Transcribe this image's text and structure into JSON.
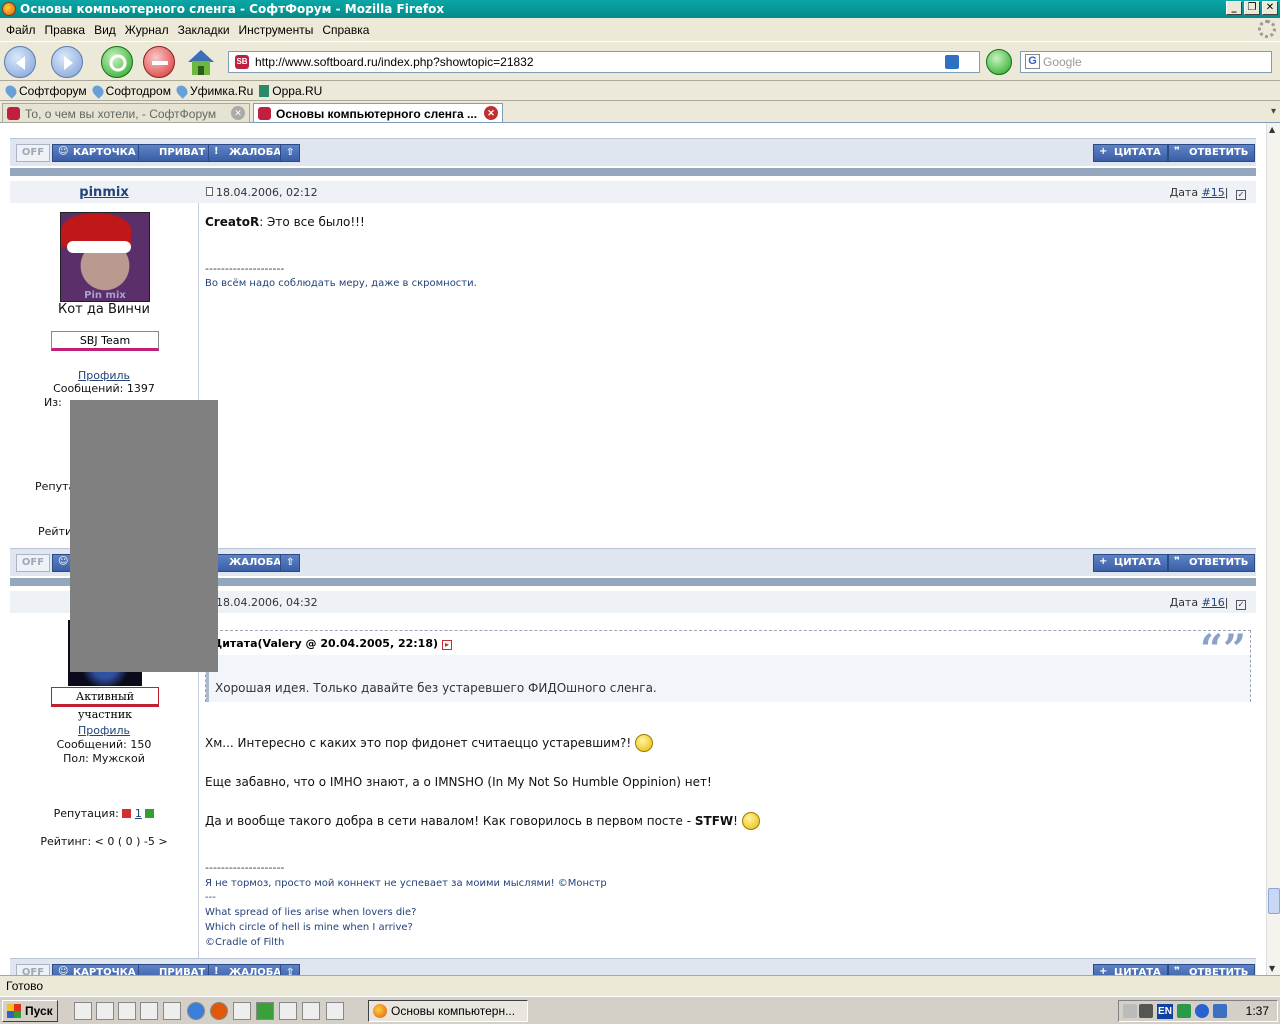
{
  "window": {
    "title": "Основы компьютерного сленга - СофтФорум - Mozilla Firefox",
    "buttons": [
      "_",
      "❐",
      "✕"
    ]
  },
  "menu": [
    "Файл",
    "Правка",
    "Вид",
    "Журнал",
    "Закладки",
    "Инструменты",
    "Справка"
  ],
  "nav": {
    "url": "http://www.softboard.ru/index.php?showtopic=21832",
    "search_placeholder": "Google"
  },
  "bookmarks": [
    "Софтфорум",
    "Софтодром",
    "Уфимка.Ru",
    "Oppa.RU"
  ],
  "tabs": [
    {
      "label": "То, о чем вы хотели, - СофтФорум"
    },
    {
      "label": "Основы компьютерного сленга ..."
    }
  ],
  "postbar": {
    "off": "OFF",
    "card": "КАРТОЧКА",
    "private": "ПРИВАТ",
    "complaint": "ЖАЛОБА",
    "up": "⇧",
    "quote": "ЦИТАТА",
    "reply": "ОТВЕТИТЬ"
  },
  "post15": {
    "author": "pinmix",
    "avatar_label": "Pin   mix",
    "title": "Кот да Винчи",
    "rank": "SBJ Team",
    "profile": "Профиль",
    "messages": "Сообщений: 1397",
    "from": "Из: ",
    "rep_label": "Репута",
    "rating_label": "Рейти",
    "date": "18.04.2006, 02:12",
    "date_label": "Дата",
    "num": "#15",
    "bold_name": "CreatoR",
    "text": ": Это все было!!!",
    "dashes": "--------------------",
    "sig": "Во всём надо соблюдать меру, даже в скромности."
  },
  "post16": {
    "rank": "Активный участник",
    "profile": "Профиль",
    "messages": "Сообщений: 150",
    "gender": "Пол: Мужской",
    "rep_label": "Репутация:",
    "rep_value": "1",
    "rating": "Рейтинг: < 0 ( 0 ) -5 >",
    "date": "18.04.2006, 04:32",
    "date_label": "Дата",
    "num": "#16",
    "quote_head": "Цитата(Valery @ 20.04.2005, 22:18)",
    "quote_text": "Хорошая идея. Только давайте без устаревшего ФИДОшного сленга.",
    "line1": "Хм... Интересно с каких это пор фидонет считаеццо устаревшим?!",
    "line2": "Еще забавно, что о IMHO знают, а о IMNSHO (In My Not So Humble Oppinion) нет!",
    "line3a": "Да и вообще такого добра в сети навалом! Как говорилось в первом посте - ",
    "line3b": "STFW",
    "line3c": "!",
    "dashes": "--------------------",
    "sig1": "Я не тормоз, просто мой коннект не успевает за моими мыслями! ©Монстр",
    "sig2": "---",
    "sig3": "What spread of lies arise when lovers die?",
    "sig4": "Which circle of hell is mine when I arrive?",
    "sig5": "©Cradle of Filth"
  },
  "status": "Готово",
  "taskbar": {
    "start": "Пуск",
    "task": "Основы компьютерн...",
    "lang": "EN",
    "clock": "1:37"
  }
}
